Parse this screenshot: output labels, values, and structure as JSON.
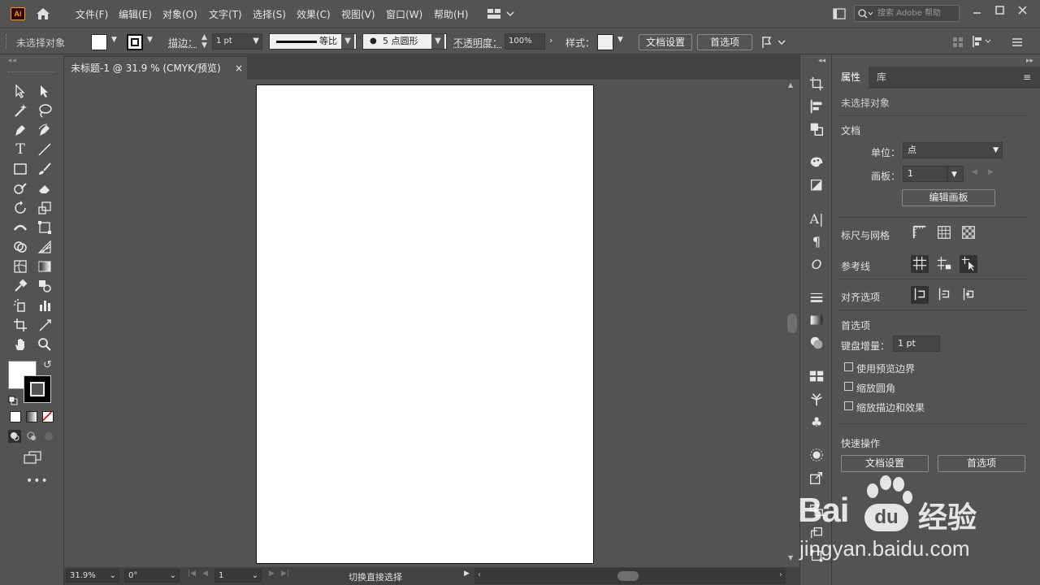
{
  "app": {
    "logo": "Ai"
  },
  "menu": [
    "文件(F)",
    "编辑(E)",
    "对象(O)",
    "文字(T)",
    "选择(S)",
    "效果(C)",
    "视图(V)",
    "窗口(W)",
    "帮助(H)"
  ],
  "search": {
    "placeholder": "搜索 Adobe 帮助"
  },
  "control": {
    "selection_status": "未选择对象",
    "stroke_label": "描边：",
    "stroke_weight": "1 pt",
    "stroke_profile": "等比",
    "brush": "5 点圆形",
    "opacity_label": "不透明度：",
    "opacity": "100%",
    "style_label": "样式：",
    "doc_setup": "文档设置",
    "preferences": "首选项"
  },
  "document": {
    "tab_title": "未标题-1 @ 31.9 % (CMYK/预览)",
    "close": "×"
  },
  "status": {
    "zoom": "31.9%",
    "rotation": "0°",
    "artboard": "1",
    "tool_hint": "切换直接选择"
  },
  "panel": {
    "tabs": [
      "属性",
      "库"
    ],
    "no_selection": "未选择对象",
    "document_section": "文档",
    "units_label": "单位：",
    "units_value": "点",
    "artboard_label": "画板：",
    "artboard_value": "1",
    "edit_artboards": "编辑画板",
    "rulers_grids": "标尺与网格",
    "guides": "参考线",
    "snap_options": "对齐选项",
    "preferences_section": "首选项",
    "keyboard_increment_label": "键盘增量：",
    "keyboard_increment": "1 pt",
    "checkboxes": [
      "使用预览边界",
      "缩放圆角",
      "缩放描边和效果"
    ],
    "quick_actions": "快速操作",
    "doc_setup_button": "文档设置",
    "preferences_button": "首选项"
  },
  "watermark": {
    "brand": "Bai",
    "brand2": "du",
    "cn": "经验",
    "url": "jingyan.baidu.com"
  },
  "colors": {
    "ui_bg": "#535353",
    "tab_bg": "#424242",
    "artboard": "#ffffff",
    "logo_orange": "#ff9a00"
  }
}
